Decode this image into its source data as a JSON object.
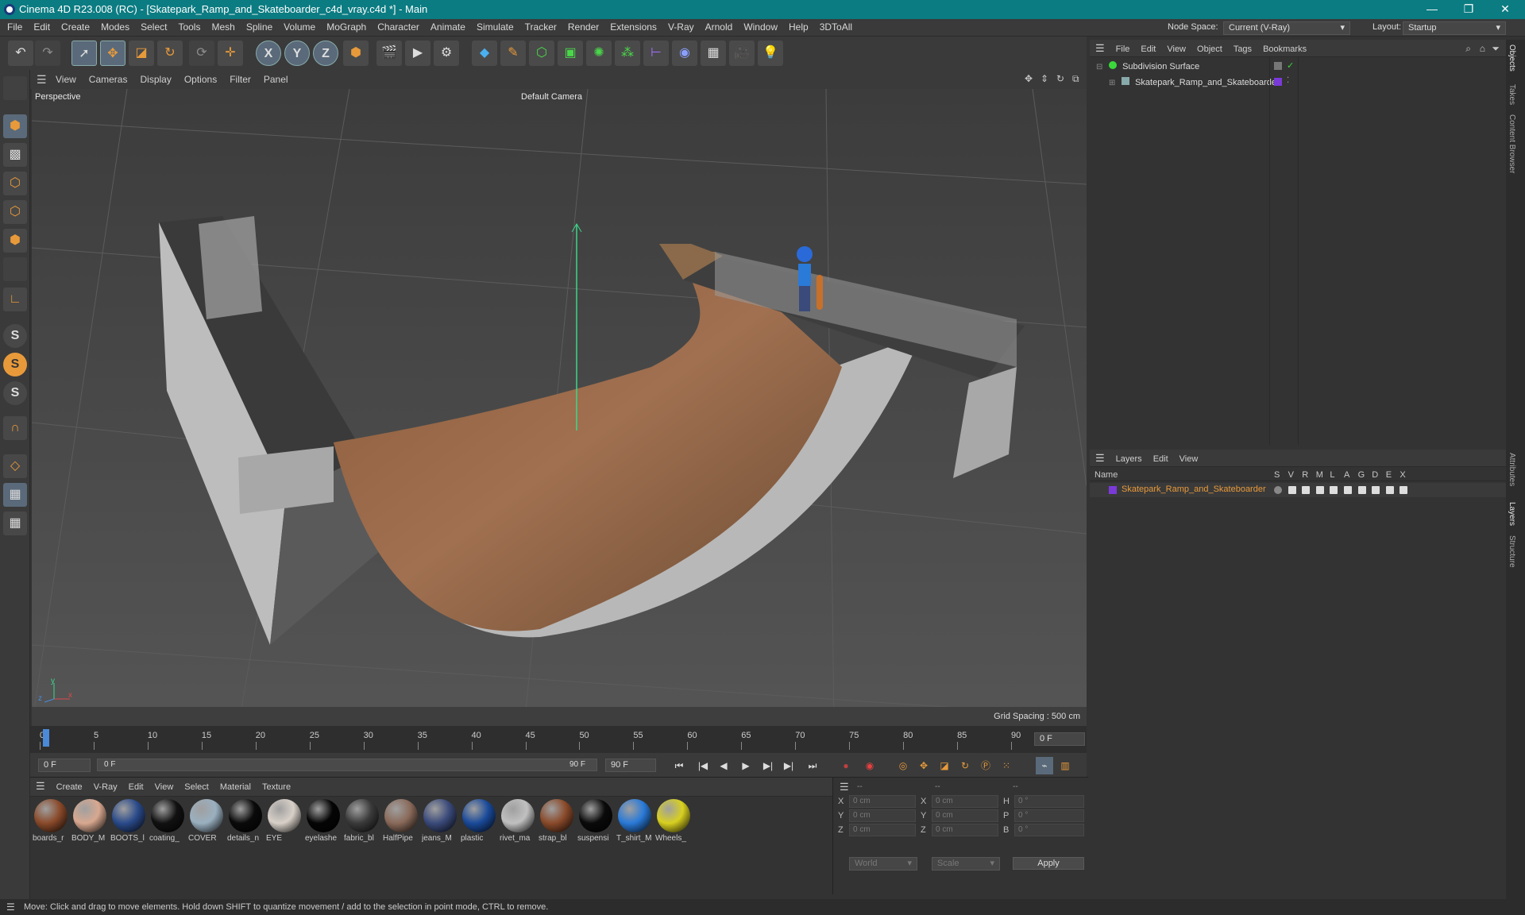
{
  "title_bar": {
    "title": "Cinema 4D R23.008 (RC) - [Skatepark_Ramp_and_Skateboarder_c4d_vray.c4d *] - Main",
    "minimize": "—",
    "restore": "❐",
    "close": "✕"
  },
  "menu": {
    "items": [
      "File",
      "Edit",
      "Create",
      "Modes",
      "Select",
      "Tools",
      "Mesh",
      "Spline",
      "Volume",
      "MoGraph",
      "Character",
      "Animate",
      "Simulate",
      "Tracker",
      "Render",
      "Extensions",
      "V-Ray",
      "Arnold",
      "Window",
      "Help",
      "3DToAll"
    ],
    "node_space_label": "Node Space:",
    "node_space_value": "Current (V-Ray)",
    "layout_label": "Layout:",
    "layout_value": "Startup"
  },
  "toolbar": {
    "icons": [
      "undo-icon",
      "redo-icon",
      "live-selection-icon",
      "move-icon",
      "scale-icon",
      "rotate-icon",
      "recent-tool-icon",
      "coordinate-icon",
      "x-axis-icon",
      "y-axis-icon",
      "z-axis-icon",
      "world-coord-icon",
      "render-region-icon",
      "render-view-icon",
      "render-settings-icon",
      "cube-icon",
      "pen-icon",
      "subdivision-icon",
      "extrude-icon",
      "cloner-icon",
      "mograph-icon",
      "deformer-icon",
      "field-icon",
      "floor-icon",
      "camera-icon",
      "light-icon"
    ],
    "axis_labels": [
      "X",
      "Y",
      "Z"
    ]
  },
  "viewport": {
    "menu": [
      "View",
      "Cameras",
      "Display",
      "Options",
      "Filter",
      "Panel"
    ],
    "label": "Perspective",
    "camera": "Default Camera",
    "grid_spacing": "Grid Spacing : 500 cm",
    "axis_x": "x",
    "axis_y": "y",
    "axis_z": "z"
  },
  "timeline": {
    "ticks": [
      "0",
      "5",
      "10",
      "15",
      "20",
      "25",
      "30",
      "35",
      "40",
      "45",
      "50",
      "55",
      "60",
      "65",
      "70",
      "75",
      "80",
      "85",
      "90"
    ],
    "current_frame": "0 F",
    "start": "0 F",
    "range_start": "0 F",
    "range_end": "90 F",
    "end": "90 F"
  },
  "materials": {
    "menu": [
      "Create",
      "V-Ray",
      "Edit",
      "View",
      "Select",
      "Material",
      "Texture"
    ],
    "items": [
      {
        "name": "boards_r",
        "color": "#8a4a2a"
      },
      {
        "name": "BODY_M",
        "color": "#d8a890"
      },
      {
        "name": "BOOTS_l",
        "color": "#2a4a8a"
      },
      {
        "name": "coating_",
        "color": "#111111"
      },
      {
        "name": "COVER",
        "color": "#9ab0c0"
      },
      {
        "name": "details_n",
        "color": "#0a0a0a"
      },
      {
        "name": "EYE",
        "color": "#d8d0c8"
      },
      {
        "name": "eyelashe",
        "color": "#050505"
      },
      {
        "name": "fabric_bl",
        "color": "#3a3a3a"
      },
      {
        "name": "HalfPipe",
        "color": "#8a6a5a"
      },
      {
        "name": "jeans_M",
        "color": "#3a4a7a"
      },
      {
        "name": "plastic",
        "color": "#1a4a9a"
      },
      {
        "name": "rivet_ma",
        "color": "#c0c0c0"
      },
      {
        "name": "strap_bl",
        "color": "#8a4a2a"
      },
      {
        "name": "suspensi",
        "color": "#0a0a0a"
      },
      {
        "name": "T_shirt_M",
        "color": "#2a7ad8"
      },
      {
        "name": "Wheels_",
        "color": "#d8d020"
      }
    ]
  },
  "coordinates": {
    "headers": [
      "--",
      "--",
      "--"
    ],
    "rows": [
      {
        "a": "X",
        "av": "0 cm",
        "b": "X",
        "bv": "0 cm",
        "c": "H",
        "cv": "0 °"
      },
      {
        "a": "Y",
        "av": "0 cm",
        "b": "Y",
        "bv": "0 cm",
        "c": "P",
        "cv": "0 °"
      },
      {
        "a": "Z",
        "av": "0 cm",
        "b": "Z",
        "bv": "0 cm",
        "c": "B",
        "cv": "0 °"
      }
    ],
    "mode": "World",
    "size_mode": "Scale",
    "apply": "Apply"
  },
  "objects": {
    "menu": [
      "File",
      "Edit",
      "View",
      "Object",
      "Tags",
      "Bookmarks"
    ],
    "tree": [
      {
        "name": "Subdivision Surface",
        "indent": 0
      },
      {
        "name": "Skatepark_Ramp_and_Skateboarder",
        "indent": 1
      }
    ]
  },
  "layers": {
    "menu": [
      "Layers",
      "Edit",
      "View"
    ],
    "col_name": "Name",
    "cols": [
      "S",
      "V",
      "R",
      "M",
      "L",
      "A",
      "G",
      "D",
      "E",
      "X"
    ],
    "rows": [
      {
        "name": "Skatepark_Ramp_and_Skateboarder",
        "color": "#7a3ad8"
      }
    ]
  },
  "side_tabs": [
    "Objects",
    "Takes",
    "Content Browser",
    "Attributes",
    "Layers",
    "Structure"
  ],
  "status": "Move: Click and drag to move elements. Hold down SHIFT to quantize movement / add to the selection in point mode, CTRL to remove.",
  "colors": {
    "title_bg": "#0b7c82",
    "accent": "#e89a3a"
  }
}
